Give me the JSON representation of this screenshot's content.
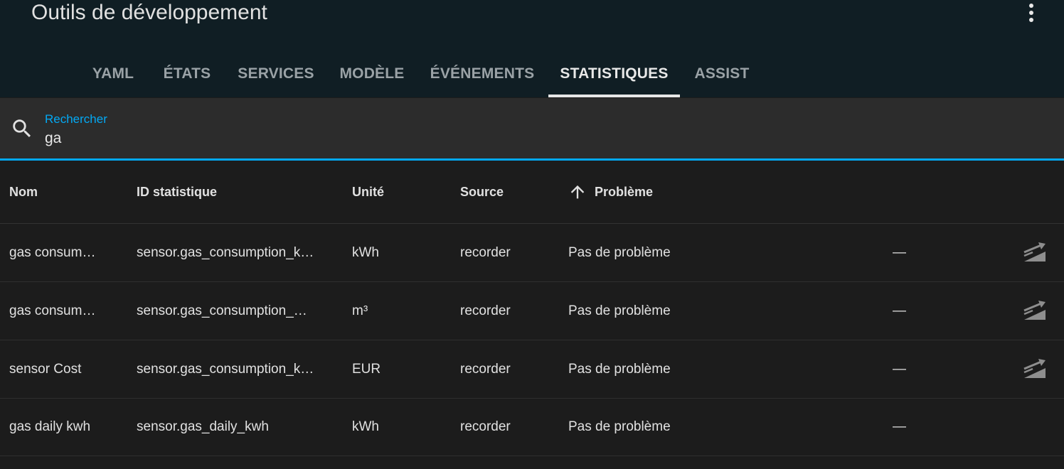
{
  "header": {
    "title": "Outils de développement"
  },
  "tabs": [
    {
      "label": "YAML"
    },
    {
      "label": "ÉTATS"
    },
    {
      "label": "SERVICES"
    },
    {
      "label": "MODÈLE"
    },
    {
      "label": "ÉVÉNEMENTS"
    },
    {
      "label": "STATISTIQUES",
      "active": true
    },
    {
      "label": "ASSIST"
    }
  ],
  "search": {
    "label": "Rechercher",
    "value": "ga"
  },
  "table": {
    "columns": [
      "Nom",
      "ID statistique",
      "Unité",
      "Source",
      "Problème"
    ],
    "sort_column": "Problème",
    "sort_direction": "ascending",
    "rows": [
      {
        "name": "gas consum…",
        "id": "sensor.gas_consumption_k…",
        "unit": "kWh",
        "source": "recorder",
        "issue": "Pas de problème",
        "extra": "—",
        "has_adjust": true
      },
      {
        "name": "gas consum…",
        "id": "sensor.gas_consumption_…",
        "unit": "m³",
        "source": "recorder",
        "issue": "Pas de problème",
        "extra": "—",
        "has_adjust": true
      },
      {
        "name": "sensor Cost",
        "id": "sensor.gas_consumption_k…",
        "unit": "EUR",
        "source": "recorder",
        "issue": "Pas de problème",
        "extra": "—",
        "has_adjust": true
      },
      {
        "name": "gas daily kwh",
        "id": "sensor.gas_daily_kwh",
        "unit": "kWh",
        "source": "recorder",
        "issue": "Pas de problème",
        "extra": "—",
        "has_adjust": false
      }
    ]
  },
  "colors": {
    "header_bg": "#101e24",
    "accent": "#03a9f4",
    "surface": "#1c1c1c"
  },
  "icons": {
    "menu": "dots-vertical-icon",
    "search": "magnify-icon",
    "sort": "arrow-up-icon",
    "adjust": "chart-adjust-icon"
  }
}
